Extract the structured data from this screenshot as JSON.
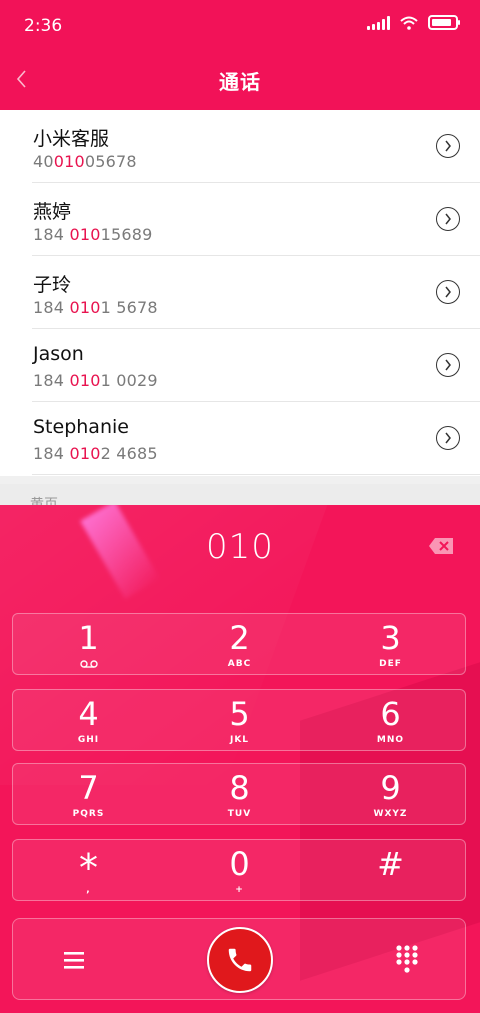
{
  "status_bar": {
    "time": "2:36",
    "battery_level": 0.85
  },
  "header": {
    "title": "通话"
  },
  "contacts": [
    {
      "name": "小米客服",
      "number_pre": "40",
      "number_match": "010",
      "number_post": "05678"
    },
    {
      "name": "燕婷",
      "number_pre": "184 ",
      "number_match": "010",
      "number_post": "15689"
    },
    {
      "name": "子玲",
      "number_pre": "184 ",
      "number_match": "010",
      "number_post": "1 5678"
    },
    {
      "name": "Jason",
      "number_pre": "184 ",
      "number_match": "010",
      "number_post": "1 0029"
    },
    {
      "name": "Stephanie",
      "number_pre": "184 ",
      "number_match": "010",
      "number_post": "2 4685"
    }
  ],
  "section": {
    "label": "黄页"
  },
  "dialer": {
    "display": "010",
    "keys": [
      {
        "digit": "1",
        "letters": ""
      },
      {
        "digit": "2",
        "letters": "ABC"
      },
      {
        "digit": "3",
        "letters": "DEF"
      },
      {
        "digit": "4",
        "letters": "GHI"
      },
      {
        "digit": "5",
        "letters": "JKL"
      },
      {
        "digit": "6",
        "letters": "MNO"
      },
      {
        "digit": "7",
        "letters": "PQRS"
      },
      {
        "digit": "8",
        "letters": "TUV"
      },
      {
        "digit": "9",
        "letters": "WXYZ"
      },
      {
        "digit": "*",
        "letters": ","
      },
      {
        "digit": "0",
        "letters": "+"
      },
      {
        "digit": "#",
        "letters": ""
      }
    ]
  },
  "icons": {
    "back": "chevron-left-icon",
    "info": "chevron-circle-right-icon",
    "backspace": "backspace-icon",
    "voicemail": "voicemail-icon",
    "menu": "menu-icon",
    "call": "phone-icon",
    "keypad": "dialpad-icon"
  },
  "colors": {
    "accent": "#f21258",
    "highlight": "#e8134f",
    "call": "#e0181c"
  }
}
